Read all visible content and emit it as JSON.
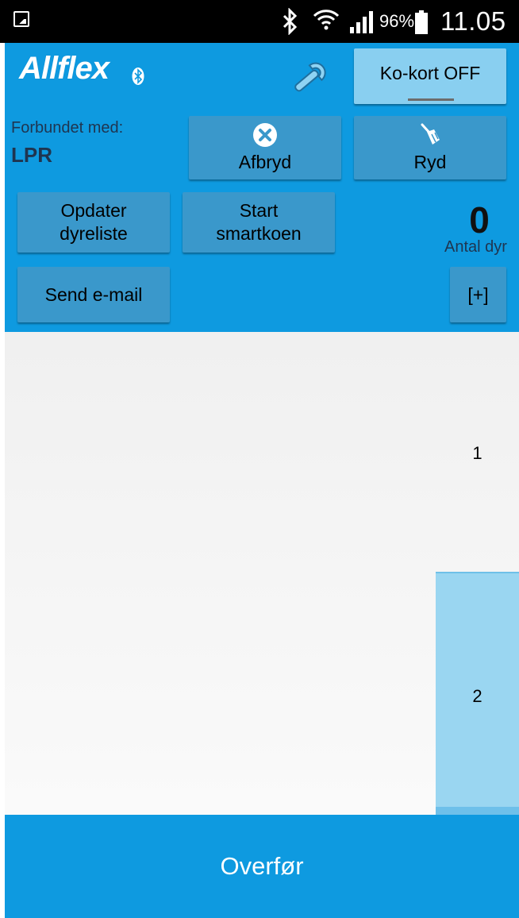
{
  "status_bar": {
    "battery": "96%",
    "time": "11.05",
    "icons": [
      "image-icon",
      "bluetooth-icon",
      "wifi-icon",
      "signal-icon",
      "battery-icon"
    ]
  },
  "header": {
    "logo": "Allflex",
    "kokort_label": "Ko-kort OFF",
    "wrench_icon": "wrench-icon"
  },
  "connection": {
    "label": "Forbundet med:",
    "value": "LPR"
  },
  "buttons": {
    "afbryd": "Afbryd",
    "ryd": "Ryd",
    "opdater_line1": "Opdater",
    "opdater_line2": "dyreliste",
    "start_line1": "Start",
    "start_line2": "smartkoen",
    "send": "Send e-mail",
    "plus": "[+]"
  },
  "counter": {
    "value": "0",
    "label": "Antal dyr"
  },
  "list": {
    "rows": [
      "1",
      "2"
    ]
  },
  "bottom": {
    "label": "Overfør"
  },
  "colors": {
    "primary": "#0e9ae0",
    "button": "#3a98cb",
    "toggle": "#89cff0",
    "selected_row": "#9ad6f1"
  }
}
